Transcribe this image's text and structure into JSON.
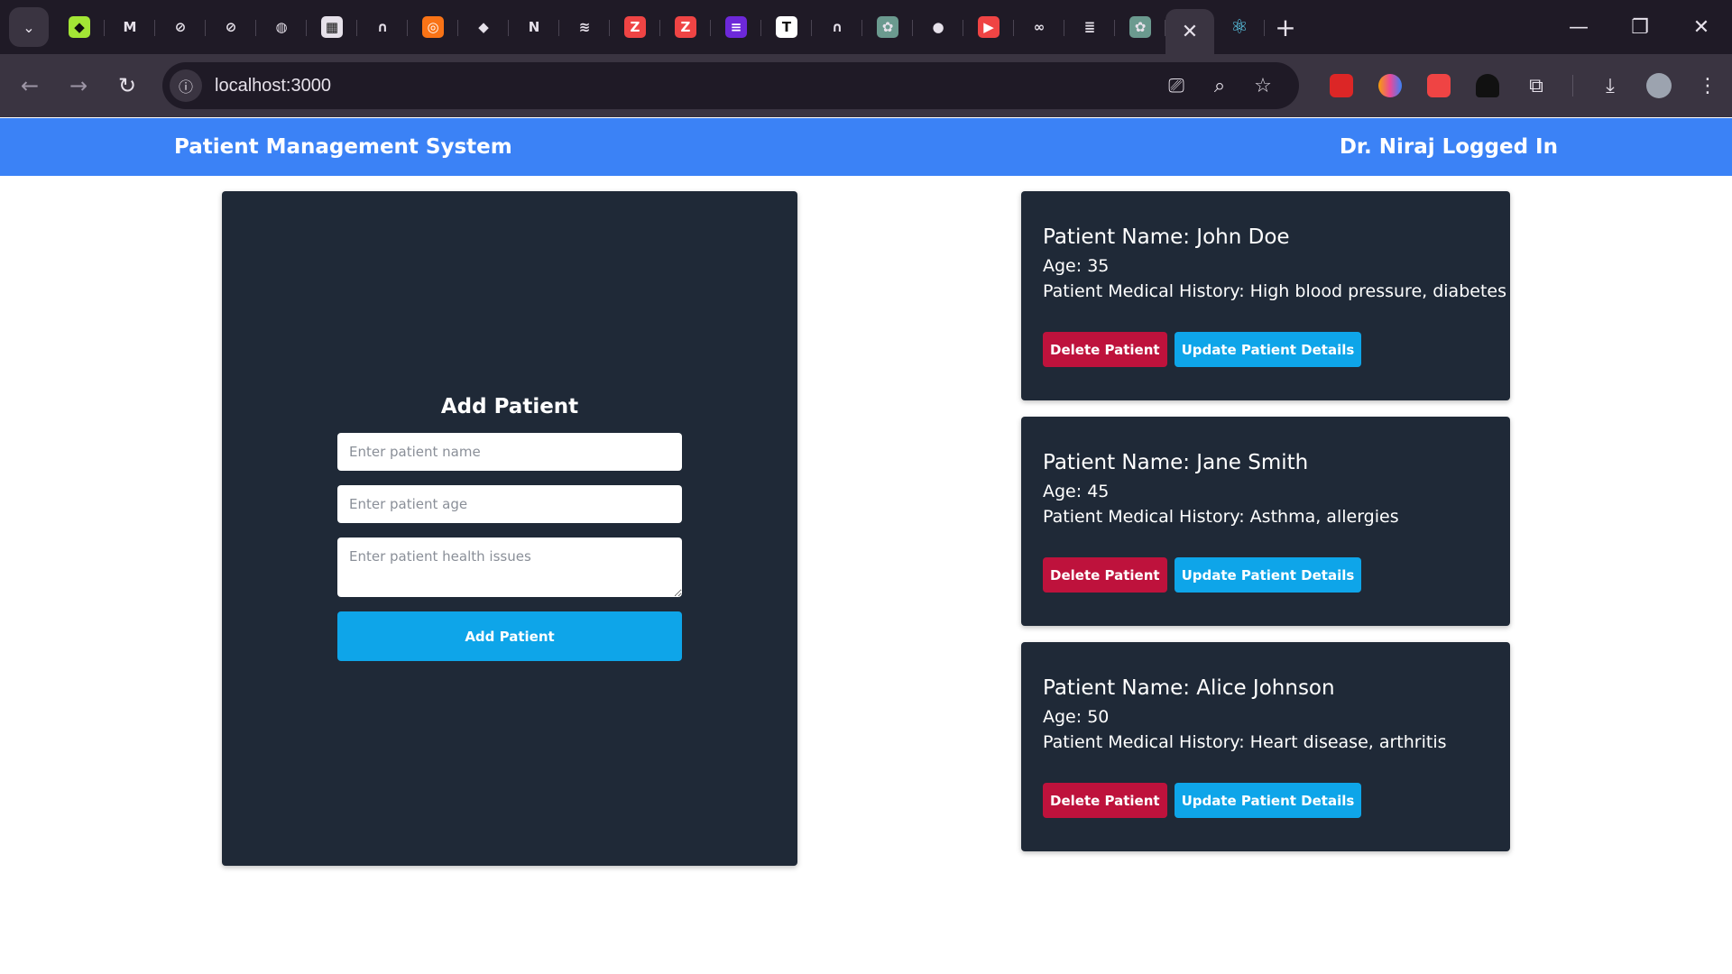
{
  "browser": {
    "tabs": [
      {
        "icon": "shield-icon",
        "color": "#a3e635",
        "glyph": "◆"
      },
      {
        "icon": "gmail-icon",
        "color": "#2a2430",
        "glyph": "M"
      },
      {
        "icon": "compass-icon",
        "color": "#2a2430",
        "glyph": "⊘"
      },
      {
        "icon": "compass-icon",
        "color": "#2a2430",
        "glyph": "⊘"
      },
      {
        "icon": "globe-icon",
        "color": "#2a2430",
        "glyph": "◍"
      },
      {
        "icon": "calendar-icon",
        "color": "#e6e1ea",
        "glyph": "▦"
      },
      {
        "icon": "headphones-icon",
        "color": "#2a2430",
        "glyph": "∩"
      },
      {
        "icon": "lifebuoy-icon",
        "color": "#f97316",
        "glyph": "◎"
      },
      {
        "icon": "code-icon",
        "color": "#2a2430",
        "glyph": "◆"
      },
      {
        "icon": "n-logo-icon",
        "color": "#2a2430",
        "glyph": "N"
      },
      {
        "icon": "stack-icon",
        "color": "#2a2430",
        "glyph": "≋"
      },
      {
        "icon": "z-logo-icon",
        "color": "#ef4444",
        "glyph": "Z"
      },
      {
        "icon": "z-logo-icon",
        "color": "#ef4444",
        "glyph": "Z"
      },
      {
        "icon": "list-icon",
        "color": "#6d28d9",
        "glyph": "≡"
      },
      {
        "icon": "t-logo-icon",
        "color": "#ffffff",
        "glyph": "T"
      },
      {
        "icon": "headphones-icon",
        "color": "#2a2430",
        "glyph": "∩"
      },
      {
        "icon": "chatgpt-icon",
        "color": "#6b9a8f",
        "glyph": "✿"
      },
      {
        "icon": "github-icon",
        "color": "#2a2430",
        "glyph": "●"
      },
      {
        "icon": "youtube-icon",
        "color": "#ef4444",
        "glyph": "▶"
      },
      {
        "icon": "infinity-icon",
        "color": "#2a2430",
        "glyph": "∞"
      },
      {
        "icon": "stackoverflow-icon",
        "color": "#2a2430",
        "glyph": "≣"
      },
      {
        "icon": "chatgpt-icon",
        "color": "#6b9a8f",
        "glyph": "✿"
      }
    ],
    "active_tab_close": "✕",
    "react_tab_icon": "⚛",
    "new_tab": "+",
    "window": {
      "minimize": "—",
      "restore": "❐",
      "close": "✕"
    },
    "url": "localhost:3000"
  },
  "app": {
    "title": "Patient Management System",
    "user_status": "Dr. Niraj Logged In",
    "form": {
      "heading": "Add Patient",
      "name_placeholder": "Enter patient name",
      "age_placeholder": "Enter patient age",
      "issues_placeholder": "Enter patient health issues",
      "submit_label": "Add Patient"
    },
    "patients": [
      {
        "name": "Patient Name: John Doe",
        "age": "Age: 35",
        "history": "Patient Medical History: High blood pressure, diabetes",
        "delete_label": "Delete Patient",
        "update_label": "Update Patient Details"
      },
      {
        "name": "Patient Name: Jane Smith",
        "age": "Age: 45",
        "history": "Patient Medical History: Asthma, allergies",
        "delete_label": "Delete Patient",
        "update_label": "Update Patient Details"
      },
      {
        "name": "Patient Name: Alice Johnson",
        "age": "Age: 50",
        "history": "Patient Medical History: Heart disease, arthritis",
        "delete_label": "Delete Patient",
        "update_label": "Update Patient Details"
      }
    ]
  },
  "colors": {
    "appbar": "#3b82f6",
    "panel": "#1f2937",
    "delete": "#be123c",
    "primary": "#0ea5e9"
  }
}
